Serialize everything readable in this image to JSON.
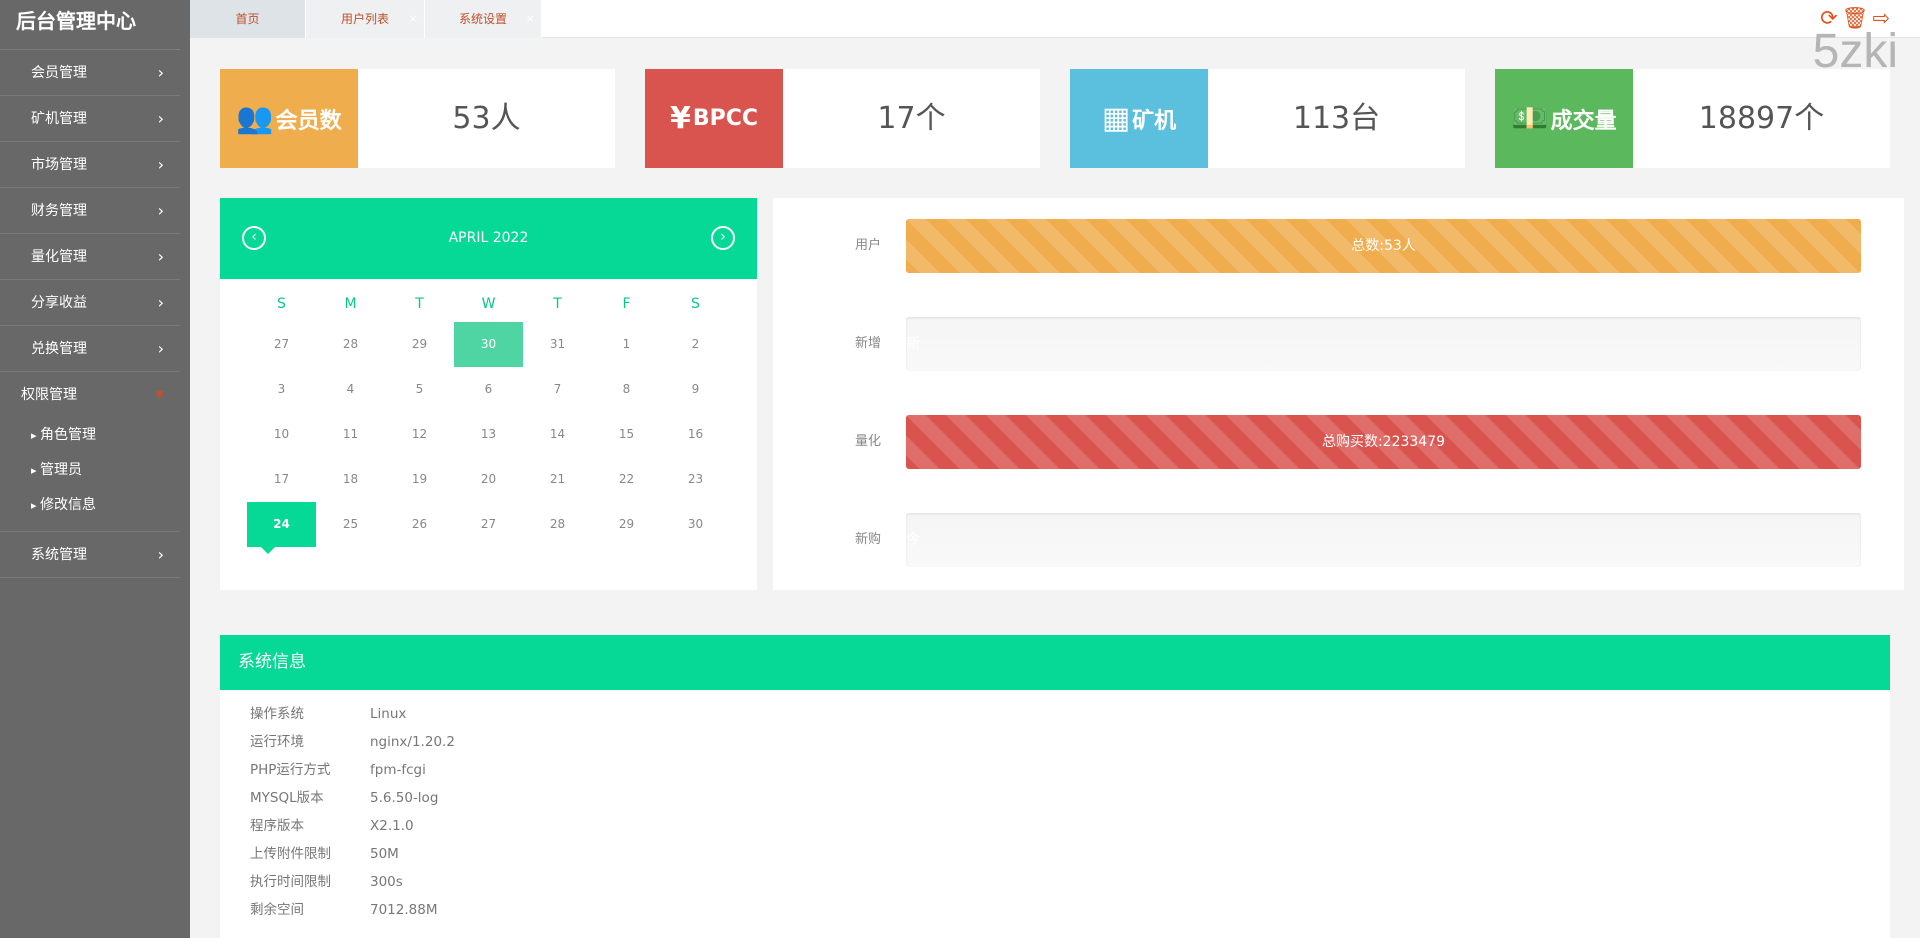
{
  "sidebar": {
    "title": "后台管理中心",
    "items": [
      "会员管理",
      "矿机管理",
      "市场管理",
      "财务管理",
      "量化管理",
      "分享收益",
      "兑换管理"
    ],
    "open": {
      "label": "权限管理",
      "children": [
        "角色管理",
        "管理员",
        "修改信息"
      ]
    },
    "last": "系统管理"
  },
  "tabs": [
    {
      "label": "首页",
      "active": true
    },
    {
      "label": "用户列表"
    },
    {
      "label": "系统设置"
    }
  ],
  "tab_close": "×",
  "toolbar": {
    "icons": [
      "refresh-icon",
      "trash-icon",
      "logout-icon"
    ]
  },
  "watermark": "5zki",
  "stats": [
    {
      "label": "会员数",
      "icon": "users-icon",
      "value": "53人",
      "color": "#f0ad4e"
    },
    {
      "label": "BPCC",
      "icon": "yen-icon",
      "value": "17个",
      "color": "#d9534f"
    },
    {
      "label": "矿机",
      "icon": "grid-icon",
      "value": "113台",
      "color": "#5bc0de"
    },
    {
      "label": "成交量",
      "icon": "money-icon",
      "value": "18897个",
      "color": "#5cb85c"
    }
  ],
  "calendar": {
    "month": "APRIL 2022",
    "weekdays": [
      "S",
      "M",
      "T",
      "W",
      "T",
      "F",
      "S"
    ],
    "days": [
      "27",
      "28",
      "29",
      "30",
      "31",
      "1",
      "2",
      "3",
      "4",
      "5",
      "6",
      "7",
      "8",
      "9",
      "10",
      "11",
      "12",
      "13",
      "14",
      "15",
      "16",
      "17",
      "18",
      "19",
      "20",
      "21",
      "22",
      "23",
      "24",
      "25",
      "26",
      "27",
      "28",
      "29",
      "30"
    ],
    "selected": "30",
    "today": "24"
  },
  "progress": [
    {
      "label": "用户",
      "text": "总数:53人",
      "percent": 100,
      "color": "#f0ad4e"
    },
    {
      "label": "新增",
      "text": "新",
      "percent": 0,
      "color": "#5cb85c"
    },
    {
      "label": "量化",
      "text": "总购买数:2233479",
      "percent": 100,
      "color": "#d9534f"
    },
    {
      "label": "新购",
      "text": "今",
      "percent": 0,
      "color": "#5bc0de"
    }
  ],
  "system": {
    "title": "系统信息",
    "rows": [
      {
        "k": "操作系统",
        "v": "Linux"
      },
      {
        "k": "运行环境",
        "v": "nginx/1.20.2"
      },
      {
        "k": "PHP运行方式",
        "v": "fpm-fcgi"
      },
      {
        "k": "MYSQL版本",
        "v": "5.6.50-log"
      },
      {
        "k": "程序版本",
        "v": "X2.1.0"
      },
      {
        "k": "上传附件限制",
        "v": "50M"
      },
      {
        "k": "执行时间限制",
        "v": "300s"
      },
      {
        "k": "剩余空间",
        "v": "7012.88M"
      }
    ]
  }
}
